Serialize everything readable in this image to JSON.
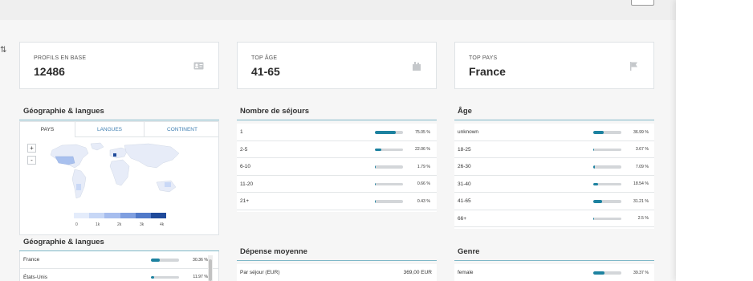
{
  "kpis": [
    {
      "label": "PROFILS EN BASE",
      "value": "12486",
      "icon": "id-card-icon"
    },
    {
      "label": "TOP ÂGE",
      "value": "41-65",
      "icon": "building-icon"
    },
    {
      "label": "TOP PAYS",
      "value": "France",
      "icon": "flag-icon"
    }
  ],
  "geo": {
    "title": "Géographie & langues",
    "tabs": [
      "PAYS",
      "LANGUES",
      "CONTINENT"
    ],
    "zoom_in": "+",
    "zoom_out": "-",
    "legend_ticks": [
      "0",
      "1k",
      "2k",
      "3k",
      "4k"
    ],
    "legend_colors": [
      "#e4ecfb",
      "#c7d7f6",
      "#a6bdee",
      "#7f9fe0",
      "#5079c9",
      "#1f4a9a"
    ]
  },
  "geo_list": {
    "title": "Géographie & langues",
    "rows": [
      {
        "label": "France",
        "pct": "30.36 %",
        "ratio": 0.3036
      },
      {
        "label": "États-Unis",
        "pct": "11.97 %",
        "ratio": 0.1197
      }
    ]
  },
  "sejours": {
    "title": "Nombre de séjours",
    "rows": [
      {
        "label": "1",
        "pct": "75.05 %",
        "ratio": 0.7505
      },
      {
        "label": "2-5",
        "pct": "22.06 %",
        "ratio": 0.2206
      },
      {
        "label": "6-10",
        "pct": "1.79 %",
        "ratio": 0.0179
      },
      {
        "label": "11-20",
        "pct": "0.66 %",
        "ratio": 0.0066
      },
      {
        "label": "21+",
        "pct": "0.43 %",
        "ratio": 0.0043
      }
    ]
  },
  "age": {
    "title": "Âge",
    "rows": [
      {
        "label": "unknown",
        "pct": "36.99 %",
        "ratio": 0.3699
      },
      {
        "label": "18-25",
        "pct": "3.67 %",
        "ratio": 0.0367
      },
      {
        "label": "26-30",
        "pct": "7.09 %",
        "ratio": 0.0709
      },
      {
        "label": "31-40",
        "pct": "18.54 %",
        "ratio": 0.1854
      },
      {
        "label": "41-65",
        "pct": "31.21 %",
        "ratio": 0.3121
      },
      {
        "label": "66+",
        "pct": "2.5 %",
        "ratio": 0.025
      }
    ]
  },
  "depense": {
    "title": "Dépense moyenne",
    "rows": [
      {
        "label": "Par séjour (EUR)",
        "value": "369,00 EUR"
      }
    ]
  },
  "genre": {
    "title": "Genre",
    "rows": [
      {
        "label": "female",
        "pct": "39.37 %",
        "ratio": 0.3937
      }
    ]
  },
  "colors": {
    "accent": "#1d82a0",
    "rule": "#7fb8c8",
    "track": "#d3d6d9"
  }
}
